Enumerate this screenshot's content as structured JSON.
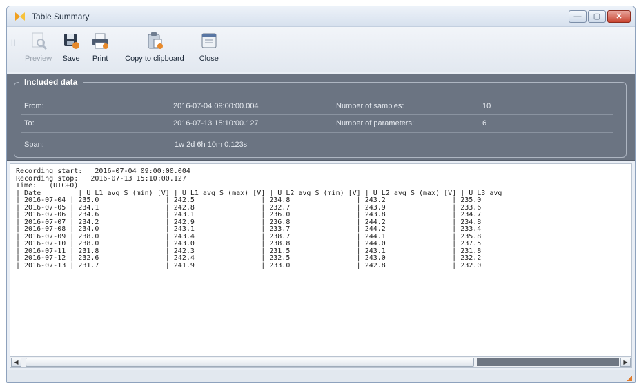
{
  "window": {
    "title": "Table Summary"
  },
  "toolbar": {
    "grip": "|||",
    "buttons": [
      {
        "label": "Preview",
        "icon": "preview-icon",
        "enabled": false
      },
      {
        "label": "Save",
        "icon": "save-icon",
        "enabled": true
      },
      {
        "label": "Print",
        "icon": "print-icon",
        "enabled": true
      },
      {
        "label": "Copy to clipboard",
        "icon": "clipboard-icon",
        "enabled": true
      },
      {
        "label": "Close",
        "icon": "close-document-icon",
        "enabled": true
      }
    ]
  },
  "included": {
    "legend": "Included data",
    "from_label": "From:",
    "from_value": "2016-07-04 09:00:00.004",
    "to_label": "To:",
    "to_value": "2016-07-13 15:10:00.127",
    "span_label": "Span:",
    "span_value": "1w 2d 6h 10m 0.123s",
    "samples_label": "Number of samples:",
    "samples_value": "10",
    "params_label": "Number of parameters:",
    "params_value": "6"
  },
  "report": {
    "recording_start": "Recording start:   2016-07-04 09:00:00.004",
    "recording_stop": "Recording stop:   2016-07-13 15:10:00.127",
    "time": "Time:   (UTC+0)",
    "header": "| Date         | U L1 avg S (min) [V] | U L1 avg S (max) [V] | U L2 avg S (min) [V] | U L2 avg S (max) [V] | U L3 avg",
    "rows": [
      "| 2016-07-04 | 235.0                | 242.5                | 234.8                | 243.2                | 235.0",
      "| 2016-07-05 | 234.1                | 242.8                | 232.7                | 243.9                | 233.6",
      "| 2016-07-06 | 234.6                | 243.1                | 236.0                | 243.8                | 234.7",
      "| 2016-07-07 | 234.2                | 242.9                | 236.8                | 244.2                | 234.8",
      "| 2016-07-08 | 234.0                | 243.1                | 233.7                | 244.2                | 233.4",
      "| 2016-07-09 | 238.0                | 243.4                | 238.7                | 244.1                | 235.8",
      "| 2016-07-10 | 238.0                | 243.0                | 238.8                | 244.0                | 237.5",
      "| 2016-07-11 | 231.8                | 242.3                | 231.5                | 243.1                | 231.8",
      "| 2016-07-12 | 232.6                | 242.4                | 232.5                | 243.0                | 232.2",
      "| 2016-07-13 | 231.7                | 241.9                | 233.0                | 242.8                | 232.0"
    ]
  },
  "scrollbar": {
    "left_arrow": "◀",
    "right_arrow": "▶"
  }
}
